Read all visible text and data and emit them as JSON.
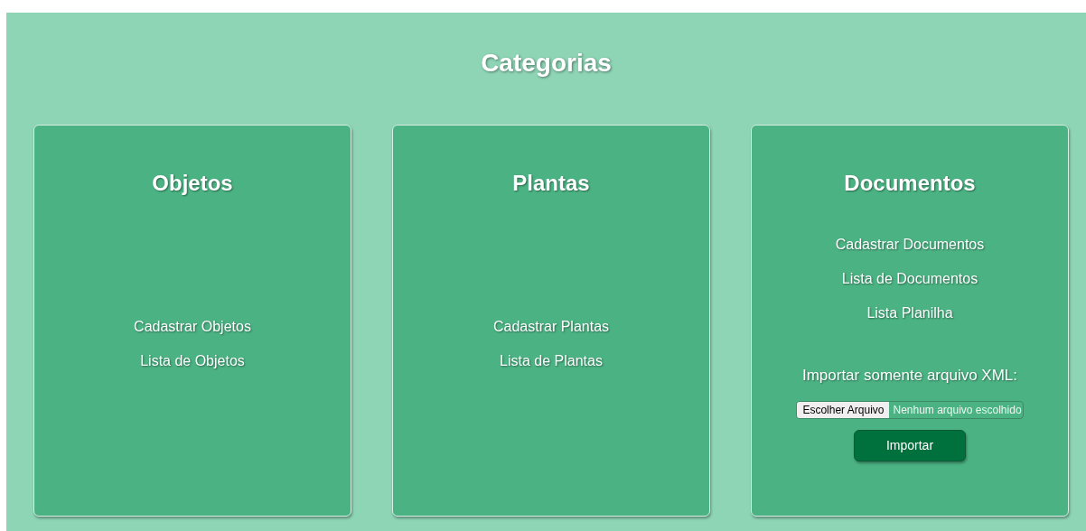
{
  "title": "Categorias",
  "cards": [
    {
      "title": "Objetos",
      "links": [
        "Cadastrar Objetos",
        "Lista de Objetos"
      ]
    },
    {
      "title": "Plantas",
      "links": [
        "Cadastrar Plantas",
        "Lista de Plantas"
      ]
    },
    {
      "title": "Documentos",
      "links": [
        "Cadastrar Documentos",
        "Lista de Documentos",
        "Lista Planilha"
      ],
      "import": {
        "label": "Importar somente arquivo XML:",
        "choose_button": "Escolher Arquivo",
        "file_status": "Nenhum arquivo escolhido",
        "submit": "Importar"
      }
    }
  ]
}
